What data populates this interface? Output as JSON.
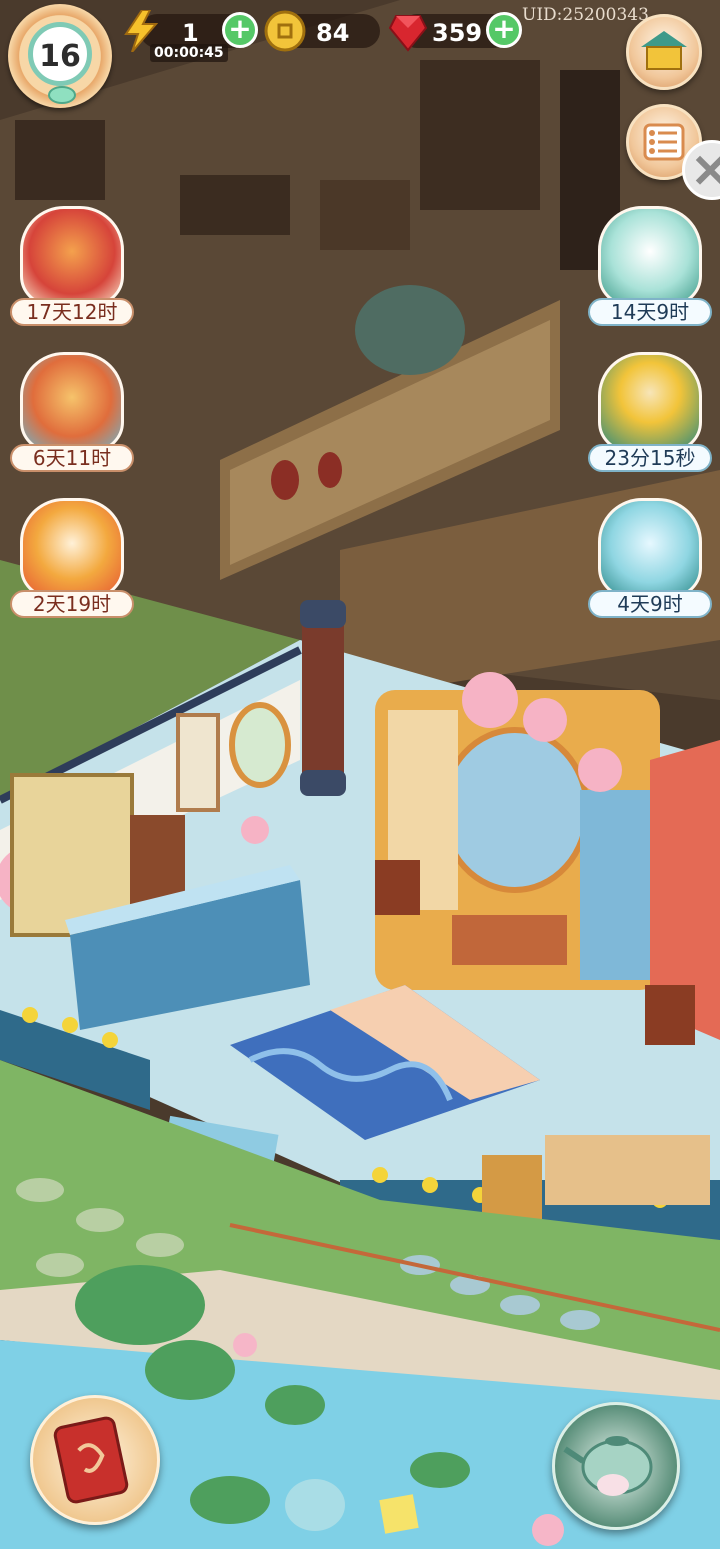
{
  "hud": {
    "level": "16",
    "energy": "1",
    "energy_timer": "00:00:45",
    "coins": "84",
    "gems": "359",
    "uid": "UID:25200343",
    "plus_symbol": "+"
  },
  "events_left": [
    {
      "name": "event-scroll-pack",
      "timer": "17天12时"
    },
    {
      "name": "event-phoenix-tree",
      "timer": "6天11时"
    },
    {
      "name": "event-lucky-cat",
      "timer": "2天19时"
    }
  ],
  "events_right": [
    {
      "name": "event-cat-cloud",
      "timer": "14天9时"
    },
    {
      "name": "event-cat-treasure-cart",
      "timer": "23分15秒"
    },
    {
      "name": "event-spirit-gift-box",
      "timer": "4天9时"
    }
  ],
  "colors": {
    "accent_green": "#55c867",
    "label_left_text": "#7a2e1f",
    "label_right_text": "#1f3b57"
  },
  "icons": [
    "level-badge-icon",
    "lightning-icon",
    "gold-coin-icon",
    "ruby-gem-icon",
    "shop-pavilion-icon",
    "list-menu-icon",
    "close-icon",
    "recipe-book-icon",
    "teapot-icon"
  ]
}
